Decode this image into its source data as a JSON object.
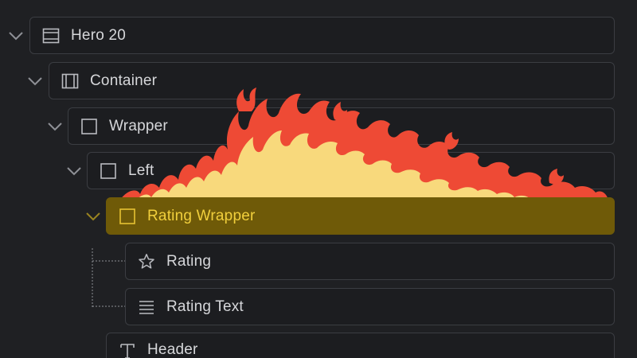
{
  "tree": {
    "items": [
      {
        "label": "Hero 20",
        "icon": "section-icon"
      },
      {
        "label": "Container",
        "icon": "container-icon"
      },
      {
        "label": "Wrapper",
        "icon": "div-block-icon"
      },
      {
        "label": "Left",
        "icon": "div-block-icon"
      },
      {
        "label": "Rating Wrapper",
        "icon": "div-block-icon",
        "selected": true
      },
      {
        "label": "Rating",
        "icon": "star-icon"
      },
      {
        "label": "Rating Text",
        "icon": "text-lines-icon"
      },
      {
        "label": "Header",
        "icon": "heading-icon"
      }
    ]
  },
  "colors": {
    "background": "#1f2023",
    "row_border": "#3b3d42",
    "selected_bg": "#6f5a08",
    "selected_text": "#f1cf3c",
    "text": "#d6d7da",
    "flame_outer": "#ee4a35",
    "flame_inner": "#f8d97c"
  }
}
